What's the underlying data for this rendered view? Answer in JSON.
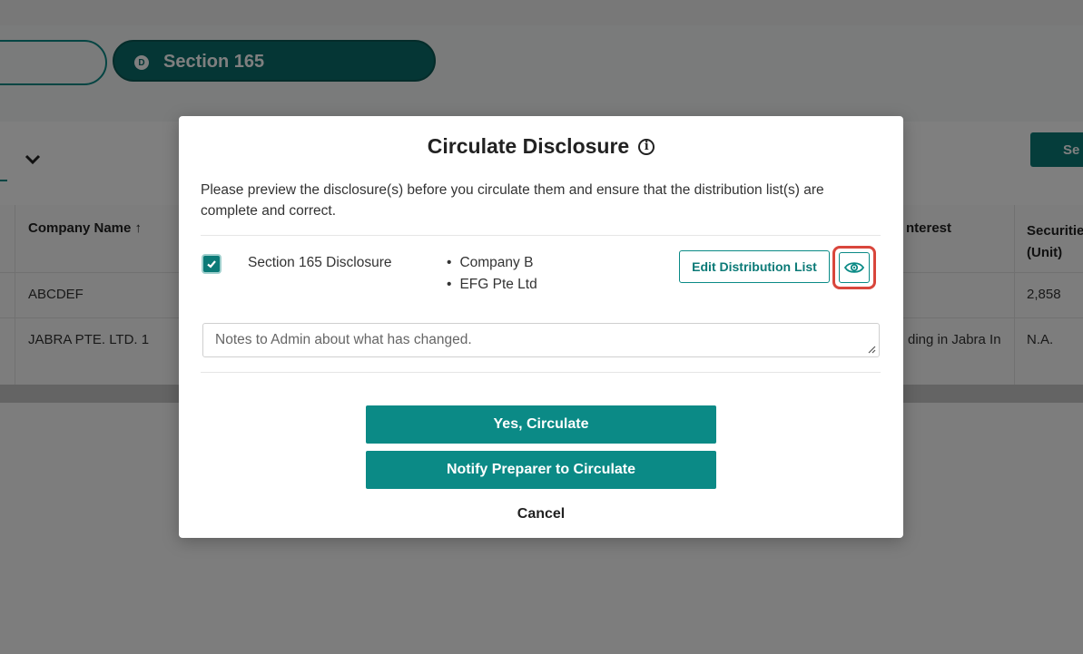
{
  "stepper": {
    "active_badge": "D",
    "active_label": "Section 165"
  },
  "filterbar": {
    "search_label": "Se"
  },
  "table": {
    "headers": {
      "company": "Company Name",
      "company_sort": "↑",
      "interest": "nterest",
      "securities_1": "Securitie",
      "securities_2": "(Unit)"
    },
    "rows": [
      {
        "company": "ABCDEF",
        "interest": "",
        "securities": "2,858"
      },
      {
        "company": "JABRA PTE. LTD. 1",
        "interest": "ding in Jabra In",
        "securities": "N.A."
      }
    ]
  },
  "modal": {
    "title": "Circulate Disclosure",
    "info_icon": "i",
    "description": "Please preview the disclosure(s) before you circulate them and ensure that the distribution list(s) are complete and correct.",
    "disclosure": {
      "checked": true,
      "name": "Section 165 Disclosure",
      "companies": [
        "Company B",
        "EFG Pte Ltd"
      ]
    },
    "edit_button": "Edit Distribution List",
    "notes_placeholder": "Notes to Admin about what has changed.",
    "yes_button": "Yes, Circulate",
    "notify_button": "Notify Preparer to Circulate",
    "cancel": "Cancel"
  },
  "colors": {
    "accent": "#0b8a86",
    "highlight": "#d9463c"
  }
}
